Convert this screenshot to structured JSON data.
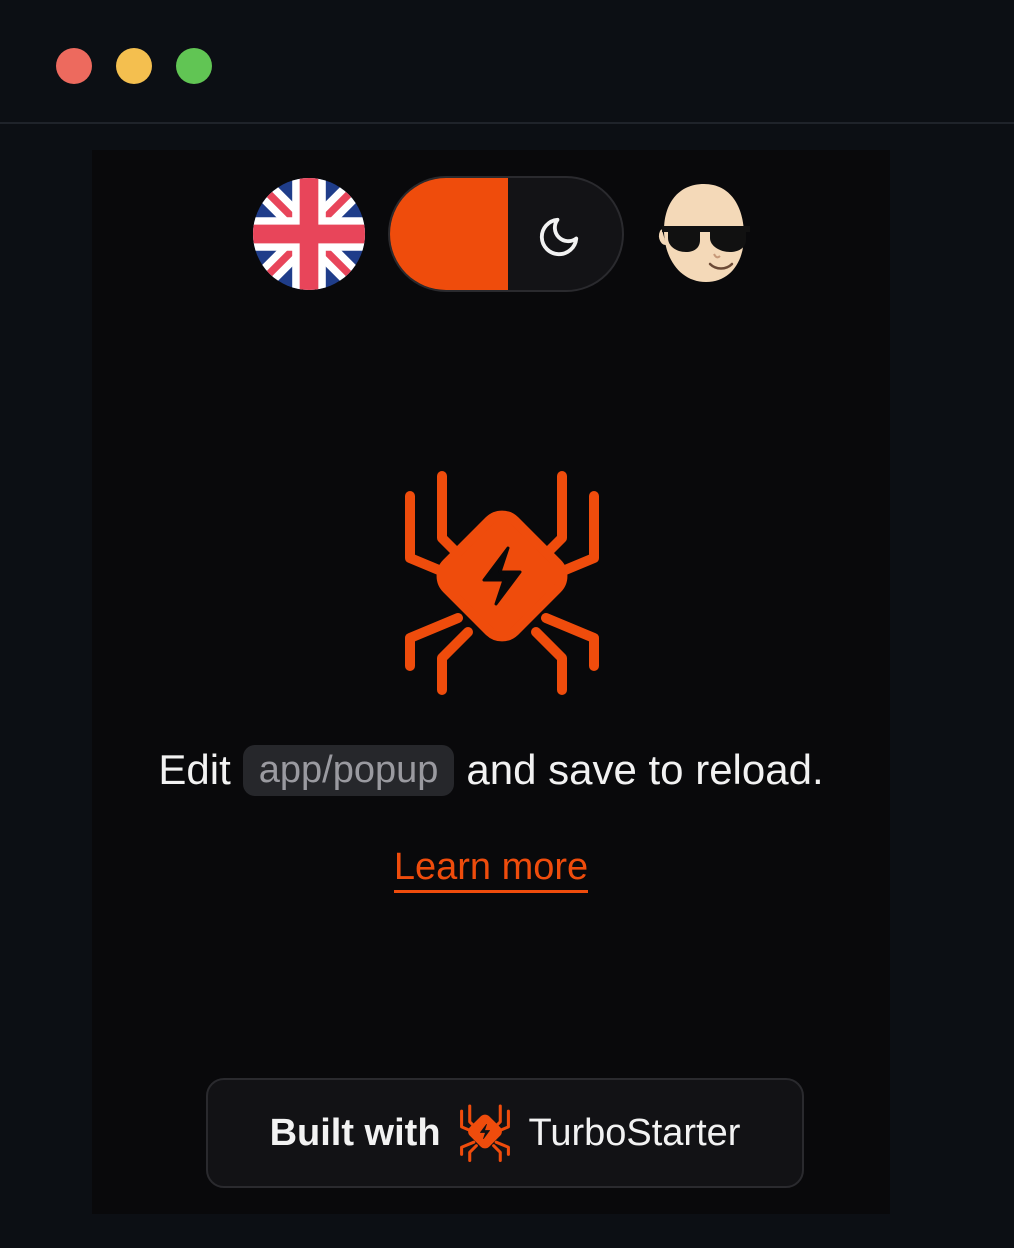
{
  "window": {
    "controls": [
      "close",
      "minimize",
      "maximize"
    ]
  },
  "header": {
    "language_flag": "uk-flag-icon",
    "theme_toggle": {
      "state": "light",
      "icon": "moon-icon"
    },
    "avatar": "user-avatar"
  },
  "main": {
    "message_before": "Edit",
    "code_path": "app/popup",
    "message_after": "and save to reload.",
    "learn_more": "Learn more"
  },
  "footer": {
    "built_with": "Built with",
    "brand": "TurboStarter"
  },
  "colors": {
    "accent": "#ef4c0c",
    "background": "#09090b",
    "window": "#0c0f14"
  }
}
